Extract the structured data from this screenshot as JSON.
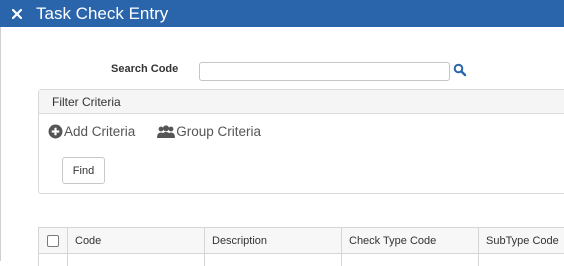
{
  "window": {
    "title": "Task Check Entry"
  },
  "search": {
    "label": "Search Code",
    "value": "",
    "placeholder": ""
  },
  "filter": {
    "title": "Filter Criteria",
    "add_label": "Add Criteria",
    "group_label": "Group Criteria",
    "find_label": "Find"
  },
  "grid": {
    "columns": [
      "Code",
      "Description",
      "Check Type Code",
      "SubType Code"
    ]
  },
  "colors": {
    "accent": "#2a64ab",
    "link_icon": "#2a64ab"
  }
}
